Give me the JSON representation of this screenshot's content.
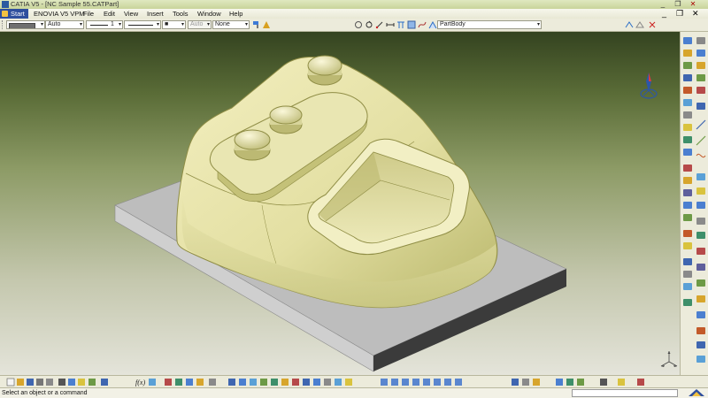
{
  "window": {
    "title": "CATIA V5 - [NC Sample 55.CATPart]",
    "controls": [
      "_",
      "❐",
      "✕"
    ]
  },
  "menubar": {
    "items": [
      "Start",
      "ENOVIA V5 VPM",
      "File",
      "Edit",
      "View",
      "Insert",
      "Tools",
      "Window",
      "Help"
    ],
    "doc_controls": [
      "_",
      "❐",
      "✕"
    ]
  },
  "properties_toolbar": {
    "line_weight_auto": "Auto",
    "line_thickness": "1",
    "point_style": "■",
    "layer_auto": "Auto",
    "layer_none": "None",
    "current_body": "PartBody"
  },
  "status": {
    "message": "Select an object or a command",
    "command_value": ""
  },
  "colors": {
    "part_fill": "#e2dfa0",
    "part_shadow": "#9b9c4c",
    "stock_top": "#bcbcbc",
    "stock_side": "#3a3a3a",
    "accent": "#2f4f9e"
  },
  "icons": {
    "compass": "compass-icon",
    "axis_triad": "axis-triad-icon",
    "catia_logo": "catia-logo-icon"
  }
}
